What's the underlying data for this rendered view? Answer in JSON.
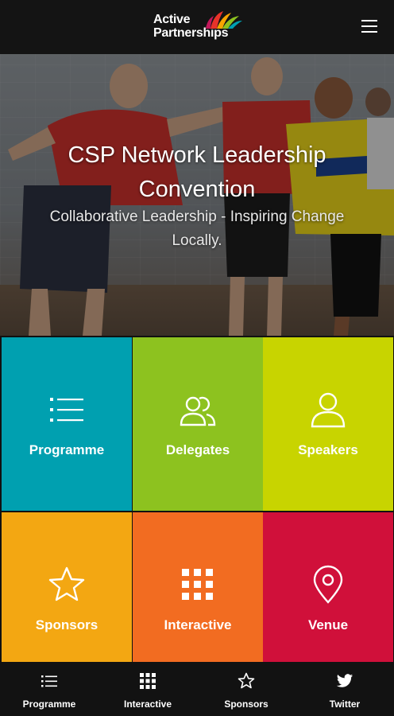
{
  "header": {
    "logo_line1": "Active",
    "logo_line2": "Partnerships",
    "menu_icon": "hamburger-menu-icon"
  },
  "hero": {
    "title": "CSP Network Leadership Convention",
    "subtitle": "Collaborative Leadership - Inspiring Change Locally."
  },
  "tiles": [
    {
      "label": "Programme",
      "icon": "list-icon",
      "color": "#00a0b0"
    },
    {
      "label": "Delegates",
      "icon": "users-icon",
      "color": "#8dc21f"
    },
    {
      "label": "Speakers",
      "icon": "user-icon",
      "color": "#c8d400"
    },
    {
      "label": "Sponsors",
      "icon": "star-icon",
      "color": "#f3a712"
    },
    {
      "label": "Interactive",
      "icon": "grid-icon",
      "color": "#f26c21"
    },
    {
      "label": "Venue",
      "icon": "map-pin-icon",
      "color": "#d0103a"
    }
  ],
  "bottom_nav": [
    {
      "label": "Programme",
      "icon": "list-icon"
    },
    {
      "label": "Interactive",
      "icon": "grid-icon"
    },
    {
      "label": "Sponsors",
      "icon": "star-icon"
    },
    {
      "label": "Twitter",
      "icon": "twitter-bird-icon"
    }
  ]
}
